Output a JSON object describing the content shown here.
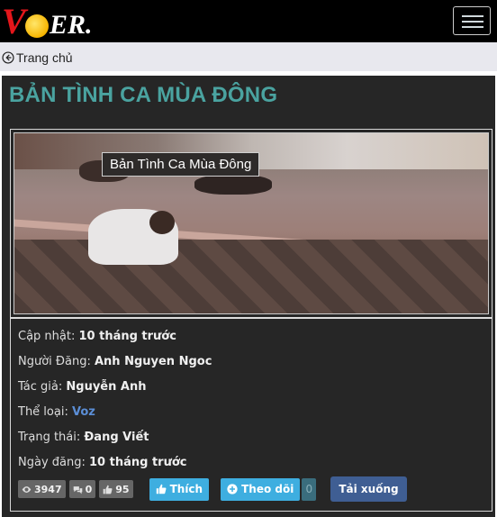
{
  "app": {
    "logo_text_v": "V",
    "logo_text_er": "ER."
  },
  "breadcrumb": {
    "home_label": "Trang chủ"
  },
  "story": {
    "title": "BẢN TÌNH CA MÙA ĐÔNG",
    "cover_tooltip": "Bản Tình Ca Mùa Đông",
    "fields": [
      {
        "label": "Cập nhật: ",
        "value": "10 tháng trước"
      },
      {
        "label": "Người Đăng: ",
        "value": "Anh Nguyen Ngoc"
      },
      {
        "label": "Tác giả: ",
        "value": "Nguyễn Anh"
      },
      {
        "label": "Thể loại: ",
        "value": "Voz"
      },
      {
        "label": "Trạng thái: ",
        "value": "Đang Viết"
      },
      {
        "label": "Ngày đăng: ",
        "value": "10 tháng trước"
      }
    ],
    "stats": {
      "views": "3947",
      "comments": "0",
      "likes": "95"
    },
    "actions": {
      "like_label": "Thích",
      "follow_label": "Theo dõi",
      "follow_count": "0",
      "download_label": "Tải xuống"
    }
  },
  "colors": {
    "title": "#4aa3a0",
    "link": "#5b8ed6",
    "like_button": "#3eaee0",
    "download_button": "#3f5e93"
  }
}
